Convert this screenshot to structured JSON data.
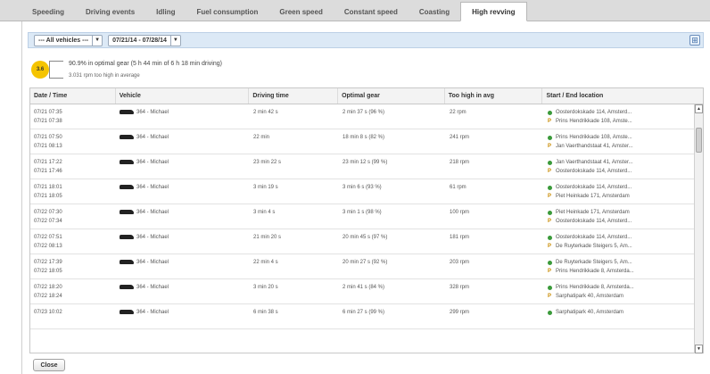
{
  "tabs": [
    {
      "label": "Speeding",
      "active": false
    },
    {
      "label": "Driving events",
      "active": false
    },
    {
      "label": "Idling",
      "active": false
    },
    {
      "label": "Fuel consumption",
      "active": false
    },
    {
      "label": "Green speed",
      "active": false
    },
    {
      "label": "Constant speed",
      "active": false
    },
    {
      "label": "Coasting",
      "active": false
    },
    {
      "label": "High revving",
      "active": true
    }
  ],
  "filters": {
    "vehicle": "--- All vehicles ---",
    "date_range": "07/21/14 - 07/28/14",
    "dropdown_arrow": "▼"
  },
  "summary": {
    "score": "3.6",
    "line1": "90.9% in optimal gear (5 h 44 min of 6 h 18 min driving)",
    "line2": "3.031 rpm too high in average"
  },
  "columns": {
    "date": "Date / Time",
    "vehicle": "Vehicle",
    "driving_time": "Driving time",
    "optimal_gear": "Optimal gear",
    "too_high": "Too high in avg",
    "location": "Start / End location"
  },
  "rows": [
    {
      "date": "07/21 07:35",
      "time2": "07/21 07:38",
      "vehicle": "364 - Michael",
      "driving_time": "2 min 42 s",
      "optimal_gear": "2 min 37 s (96 %)",
      "too_high": "22 rpm",
      "start": "Oosterdokskade 114, Amsterd...",
      "end": "Prins Hendrikkade 108, Amste..."
    },
    {
      "date": "07/21 07:50",
      "time2": "07/21 08:13",
      "vehicle": "364 - Michael",
      "driving_time": "22 min",
      "optimal_gear": "18 min 8 s (82 %)",
      "too_high": "241 rpm",
      "start": "Prins Hendrikkade 108, Amste...",
      "end": "Jan Vaerthandstaat 41, Amster..."
    },
    {
      "date": "07/21 17:22",
      "time2": "07/21 17:46",
      "vehicle": "364 - Michael",
      "driving_time": "23 min 22 s",
      "optimal_gear": "23 min 12 s (99 %)",
      "too_high": "218 rpm",
      "start": "Jan Vaerthandstaat 41, Amster...",
      "end": "Oosterdokskade 114, Amsterd..."
    },
    {
      "date": "07/21 18:01",
      "time2": "07/21 18:05",
      "vehicle": "364 - Michael",
      "driving_time": "3 min 19 s",
      "optimal_gear": "3 min 6 s (93 %)",
      "too_high": "61 rpm",
      "start": "Oosterdokskade 114, Amsterd...",
      "end": "Piet Heinkade 171, Amsterdam"
    },
    {
      "date": "07/22 07:30",
      "time2": "07/22 07:34",
      "vehicle": "364 - Michael",
      "driving_time": "3 min 4 s",
      "optimal_gear": "3 min 1 s (98 %)",
      "too_high": "100 rpm",
      "start": "Piet Heinkade 171, Amsterdam",
      "end": "Oosterdokskade 114, Amsterd..."
    },
    {
      "date": "07/22 07:51",
      "time2": "07/22 08:13",
      "vehicle": "364 - Michael",
      "driving_time": "21 min 20 s",
      "optimal_gear": "20 min 45 s (97 %)",
      "too_high": "181 rpm",
      "start": "Oosterdokskade 114, Amsterd...",
      "end": "De Ruyterkade Steigers 5, Am..."
    },
    {
      "date": "07/22 17:39",
      "time2": "07/22 18:05",
      "vehicle": "364 - Michael",
      "driving_time": "22 min 4 s",
      "optimal_gear": "20 min 27 s (92 %)",
      "too_high": "203 rpm",
      "start": "De Ruyterkade Steigers 5, Am...",
      "end": "Prins Hendrikkade 8, Amsterda..."
    },
    {
      "date": "07/22 18:20",
      "time2": "07/22 18:24",
      "vehicle": "364 - Michael",
      "driving_time": "3 min 20 s",
      "optimal_gear": "2 min 41 s (84 %)",
      "too_high": "328 rpm",
      "start": "Prins Hendrikkade 8, Amsterda...",
      "end": "Sarphatipark 40, Amsterdam"
    },
    {
      "date": "07/23 10:02",
      "time2": "",
      "vehicle": "364 - Michael",
      "driving_time": "6 min 38 s",
      "optimal_gear": "6 min 27 s (99 %)",
      "too_high": "299 rpm",
      "start": "Sarphatipark 40, Amsterdam",
      "end": ""
    }
  ],
  "scrollbar": {
    "up": "▲",
    "down": "▼"
  },
  "close_label": "Close",
  "filter_icon_glyph": "⊞"
}
